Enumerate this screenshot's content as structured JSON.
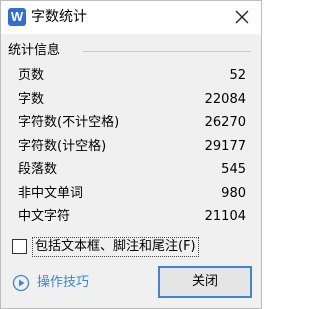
{
  "window": {
    "title": "字数统计",
    "app_icon_letter": "W"
  },
  "group": {
    "title": "统计信息"
  },
  "stats": [
    {
      "label": "页数",
      "value": "52"
    },
    {
      "label": "字数",
      "value": "22084"
    },
    {
      "label": "字符数(不计空格)",
      "value": "26270"
    },
    {
      "label": "字符数(计空格)",
      "value": "29177"
    },
    {
      "label": "段落数",
      "value": "545"
    },
    {
      "label": "非中文单词",
      "value": "980"
    },
    {
      "label": "中文字符",
      "value": "21104"
    }
  ],
  "options": {
    "include_footnotes_label": "包括文本框、脚注和尾注(F)",
    "include_footnotes_checked": false
  },
  "footer": {
    "tips_label": "操作技巧",
    "close_label": "关闭"
  },
  "colors": {
    "accent": "#3a87d8",
    "app_icon": "#2f6ed8",
    "dialog_bg": "#f0f0f0",
    "titlebar_bg": "#ffffff"
  },
  "icons": {
    "app": "wps-writer-icon",
    "close": "close-icon",
    "tips": "play-circle-icon"
  }
}
